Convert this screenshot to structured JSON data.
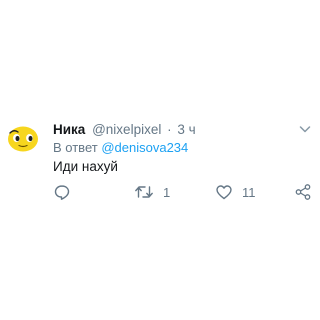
{
  "tweet": {
    "display_name": "Ника",
    "handle": "@nixelpixel",
    "separator": "·",
    "time": "3 ч",
    "reply_prefix": "В ответ",
    "reply_mention": "@denisova234",
    "text": "Иди нахуй",
    "avatar_icon": "yellow-emoji-avatar-icon",
    "menu_icon": "chevron-down-icon"
  },
  "actions": {
    "reply": {
      "icon": "reply-icon",
      "count": ""
    },
    "retweet": {
      "icon": "retweet-icon",
      "count": "1"
    },
    "like": {
      "icon": "heart-icon",
      "count": "11"
    },
    "share": {
      "icon": "share-icon",
      "count": ""
    }
  },
  "colors": {
    "text": "#14171a",
    "secondary": "#657786",
    "link": "#1da1f2",
    "avatar_yellow": "#f7d61e",
    "background": "#ffffff"
  }
}
